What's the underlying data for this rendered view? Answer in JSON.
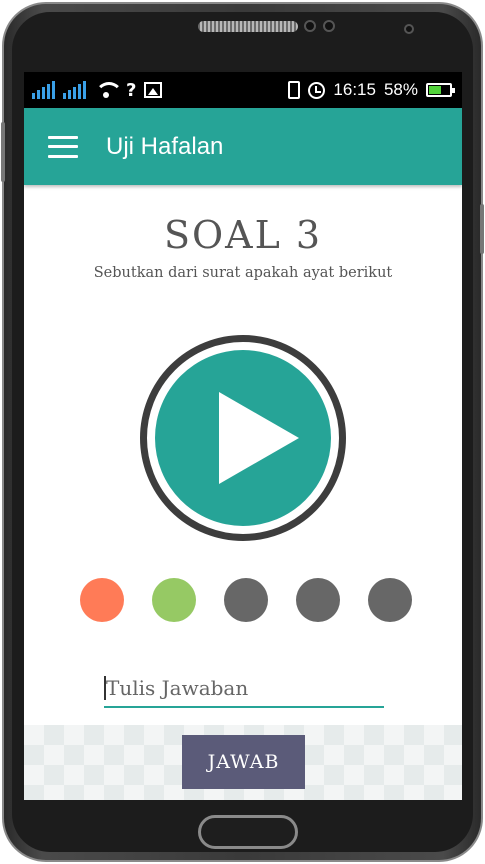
{
  "status_bar": {
    "time": "16:15",
    "battery_percent_text": "58%",
    "battery_level": 0.58,
    "icons": [
      "signal-bars-icon",
      "signal-bars-icon",
      "wifi-icon",
      "no-connection-icon",
      "image-icon",
      "vibrate-icon",
      "alarm-icon",
      "battery-icon"
    ]
  },
  "app_bar": {
    "title": "Uji Hafalan",
    "menu_icon": "hamburger-menu-icon"
  },
  "question": {
    "title": "SOAL 3",
    "subtitle": "Sebutkan dari surat apakah ayat berikut"
  },
  "player": {
    "icon": "play-icon",
    "accent_color": "#26a497"
  },
  "progress_dots": [
    {
      "status": "wrong",
      "color": "#ff7b57"
    },
    {
      "status": "correct",
      "color": "#96c964"
    },
    {
      "status": "pending",
      "color": "#676767"
    },
    {
      "status": "pending",
      "color": "#676767"
    },
    {
      "status": "pending",
      "color": "#676767"
    }
  ],
  "answer": {
    "placeholder": "Tulis Jawaban",
    "value": ""
  },
  "submit": {
    "label": "JAWAB",
    "color": "#5b5b79"
  }
}
